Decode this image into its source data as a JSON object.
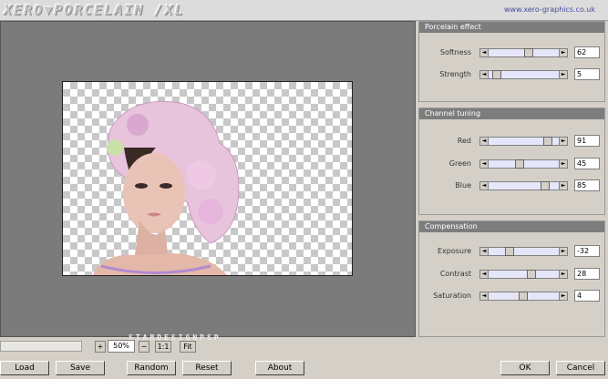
{
  "header": {
    "app_title": "XERO▼PORCELAIN /XL",
    "vendor_link": "www.xero-graphics.co.uk"
  },
  "preview": {
    "watermark": "STARDESIGNPSP"
  },
  "panels": {
    "porcelain": {
      "title": "Porcelain effect",
      "controls": [
        {
          "label": "Softness",
          "value": "62"
        },
        {
          "label": "Strength",
          "value": "5"
        }
      ]
    },
    "channel": {
      "title": "Channel tuning",
      "controls": [
        {
          "label": "Red",
          "value": "91"
        },
        {
          "label": "Green",
          "value": "45"
        },
        {
          "label": "Blue",
          "value": "85"
        }
      ]
    },
    "compensation": {
      "title": "Compensation",
      "controls": [
        {
          "label": "Exposure",
          "value": "-32"
        },
        {
          "label": "Contrast",
          "value": "28"
        },
        {
          "label": "Saturation",
          "value": "4"
        }
      ]
    }
  },
  "zoom": {
    "plus_label": "+",
    "value": "50%",
    "minus_label": "−",
    "one_to_one_label": "1:1",
    "fit_label": "Fit"
  },
  "buttons": {
    "load": "Load",
    "save": "Save",
    "random": "Random",
    "reset": "Reset",
    "about": "About",
    "ok": "OK",
    "cancel": "Cancel"
  },
  "slider_arrows": {
    "left": "◄",
    "right": "►"
  },
  "colors": {
    "panel_header": "#7d7d7d",
    "slider_track": "#e6e6fa",
    "preview_bg": "#7b7b7b",
    "dialog_bg": "#d4d0c8"
  }
}
